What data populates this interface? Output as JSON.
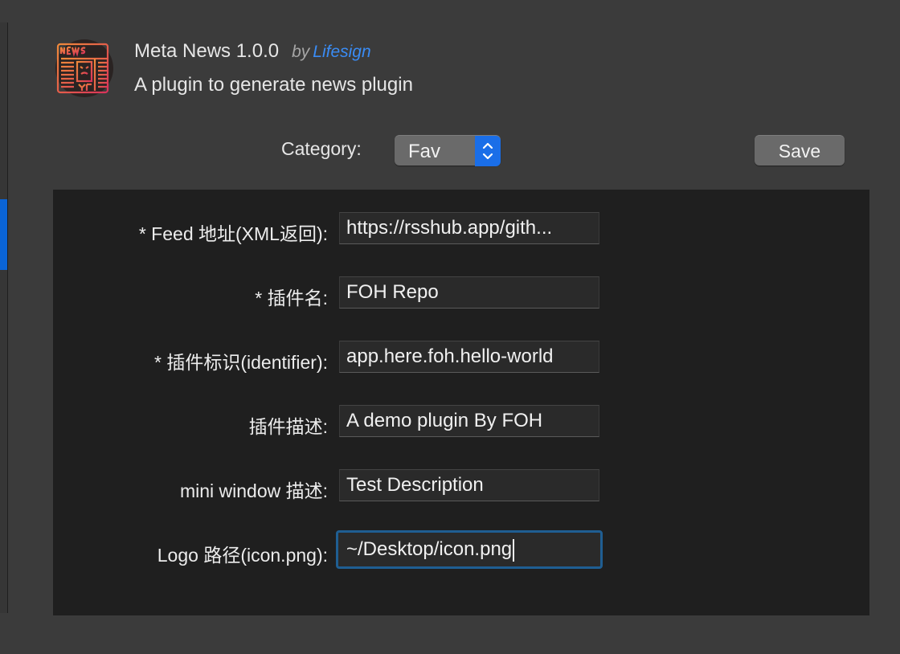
{
  "plugin": {
    "name": "Meta News 1.0.0",
    "by": "by",
    "author": "Lifesign",
    "description": "A plugin to generate news plugin",
    "icon": "newspaper-icon"
  },
  "category": {
    "label": "Category:",
    "selected": "Fav"
  },
  "save_label": "Save",
  "form": {
    "feed": {
      "label": "* Feed 地址(XML返回):",
      "value": "https://rsshub.app/gith..."
    },
    "name": {
      "label": "* 插件名:",
      "value": "FOH Repo"
    },
    "identifier": {
      "label": "* 插件标识(identifier):",
      "value": "app.here.foh.hello-world"
    },
    "description": {
      "label": "插件描述:",
      "value": "A demo plugin By FOH"
    },
    "mini_window": {
      "label": "mini window 描述:",
      "value": "Test Description"
    },
    "logo": {
      "label": "Logo 路径(icon.png):",
      "value": "~/Desktop/icon.png"
    }
  },
  "colors": {
    "accent": "#1a6ee8",
    "author_link": "#3a8cf5",
    "panel": "#1f1f1f",
    "window": "#3b3b3b"
  }
}
